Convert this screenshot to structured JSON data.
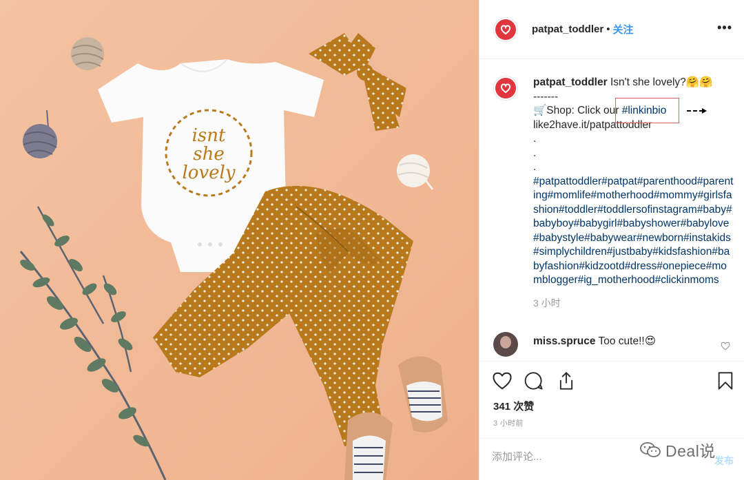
{
  "post": {
    "username": "patpat_toddler",
    "dot": "•",
    "follow_label": "关注",
    "more_label": "•••"
  },
  "caption": {
    "username": "patpat_toddler",
    "title_text": "Isn't she lovely?🤗🤗",
    "dashes": "-------",
    "shop_prefix": "🛒Shop: Click our ",
    "shop_link": "#linkinbio",
    "url": "like2have.it/patpattoddler",
    "dots": [
      ".",
      ".",
      "."
    ],
    "hashtags": "#patpattoddler#patpat#parenthood#parenting#momlife#motherhood#mommy#girlsfashion#toddler#toddlersofinstagram#baby#babyboy#babygirl#babyshower#babylove#babystyle#babywear#newborn#instakids#simplychildren#justbaby#kidsfashion#babyfashion#kidzootd#dress#onepiece#momblogger#ig_motherhood#clickinmoms",
    "time_ago": "3 小时"
  },
  "comments": [
    {
      "username": "miss.spruce",
      "text": "Too cute!!😍"
    }
  ],
  "actions": {
    "likes": "341 次赞",
    "posted": "3 小时前"
  },
  "add_comment": {
    "placeholder": "添加评论...",
    "publish_label": "发布"
  },
  "watermark": {
    "text": "Deal说"
  },
  "photo": {
    "onesie_text": [
      "isnt",
      "she",
      "lovely"
    ]
  },
  "colors": {
    "background_photo": "#f1b995",
    "mustard": "#b8791c",
    "brand_red": "#e2363f",
    "link": "#003569",
    "follow_blue": "#3897f0",
    "muted": "#999999"
  }
}
